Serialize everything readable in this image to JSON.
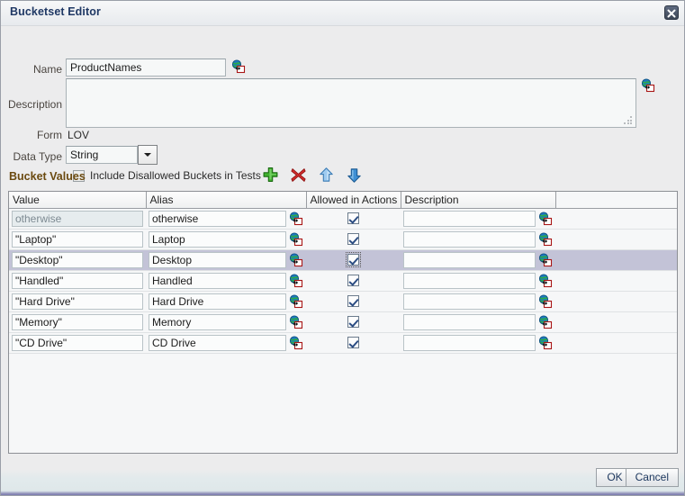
{
  "window": {
    "title": "Bucketset Editor",
    "close_icon": "close-icon"
  },
  "form": {
    "name_label": "Name",
    "name_value": "ProductNames",
    "name_placeholder": "",
    "name_picker_icon": "globe-edit-icon",
    "description_label": "Description",
    "description_value": "",
    "description_placeholder": "",
    "description_picker_icon": "globe-edit-icon",
    "form_label": "Form",
    "form_value": "LOV",
    "data_type_label": "Data Type",
    "data_type_value": "String",
    "data_type_options": [
      "String"
    ],
    "include_disallowed_label": "Include Disallowed Buckets in Tests",
    "include_disallowed_checked": false
  },
  "bucket_values": {
    "section_title": "Bucket Values",
    "toolbar": [
      {
        "name": "add-bucket-button",
        "icon": "plus-icon",
        "tooltip": "Add"
      },
      {
        "name": "delete-bucket-button",
        "icon": "delete-x-icon",
        "tooltip": "Delete"
      },
      {
        "name": "move-up-button",
        "icon": "arrow-up-icon",
        "tooltip": "Move Up"
      },
      {
        "name": "move-down-button",
        "icon": "arrow-down-icon",
        "tooltip": "Move Down"
      }
    ],
    "columns": [
      "Value",
      "Alias",
      "Allowed in Actions",
      "Description"
    ],
    "rows": [
      {
        "value": "otherwise",
        "value_readonly": true,
        "alias": "otherwise",
        "allowed": true,
        "description": "",
        "selected": false
      },
      {
        "value": "\"Laptop\"",
        "value_readonly": false,
        "alias": "Laptop",
        "allowed": true,
        "description": "",
        "selected": false
      },
      {
        "value": "\"Desktop\"",
        "value_readonly": false,
        "alias": "Desktop",
        "allowed": true,
        "description": "",
        "selected": true
      },
      {
        "value": "\"Handled\"",
        "value_readonly": false,
        "alias": "Handled",
        "allowed": true,
        "description": "",
        "selected": false
      },
      {
        "value": "\"Hard Drive\"",
        "value_readonly": false,
        "alias": "Hard Drive",
        "allowed": true,
        "description": "",
        "selected": false
      },
      {
        "value": "\"Memory\"",
        "value_readonly": false,
        "alias": "Memory",
        "allowed": true,
        "description": "",
        "selected": false
      },
      {
        "value": "\"CD Drive\"",
        "value_readonly": false,
        "alias": "CD Drive",
        "allowed": true,
        "description": "",
        "selected": false
      }
    ]
  },
  "footer": {
    "ok_label": "OK",
    "cancel_label": "Cancel"
  },
  "colors": {
    "title_text": "#1f3864",
    "section_title": "#6b4a10",
    "selected_row": "#c3c3d7",
    "add_icon": "#35a02a",
    "delete_icon": "#cc2222",
    "arrow_up_icon": "#7fb3e8",
    "arrow_down_icon": "#2f7fd0",
    "button_text": "#1b365d"
  }
}
